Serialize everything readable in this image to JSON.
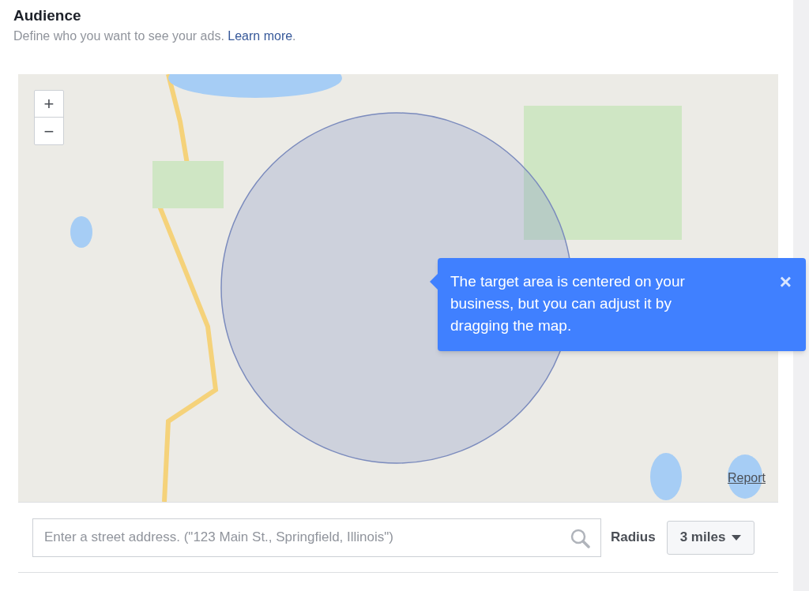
{
  "header": {
    "title": "Audience",
    "description": "Define who you want to see your ads.",
    "link": "Learn more",
    "trailing": "."
  },
  "map": {
    "zoom_in": "+",
    "zoom_out": "−",
    "report": "Report"
  },
  "tooltip": {
    "text": "The target area is centered on your business, but you can adjust it by dragging the map.",
    "close": "×"
  },
  "address": {
    "placeholder": "Enter a street address. (\"123 Main St., Springfield, Illinois\")"
  },
  "radius": {
    "label": "Radius",
    "value": "3 miles"
  }
}
